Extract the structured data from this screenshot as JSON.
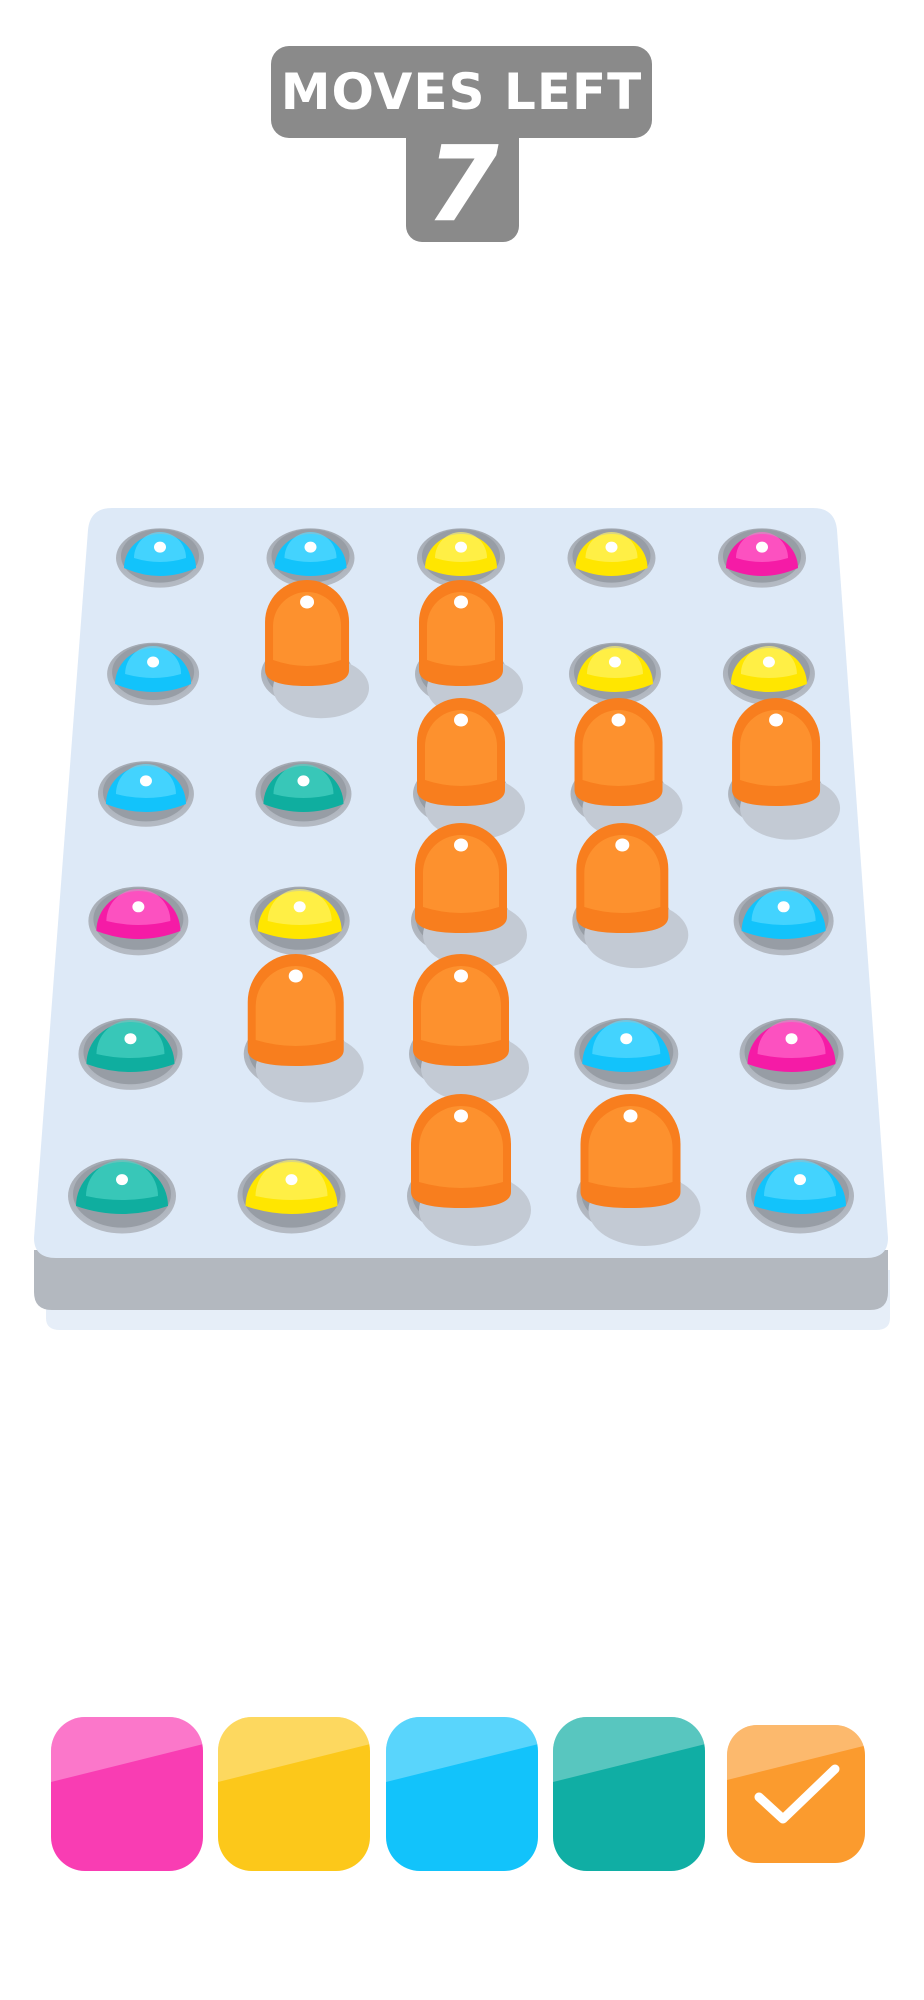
{
  "header": {
    "moves_label": "MOVES LEFT",
    "moves_value": "7"
  },
  "colors": {
    "pink": "#f93db3",
    "yellow": "#fcc81a",
    "blue": "#12c3fb",
    "teal": "#10aea4",
    "orange": "#fb9b2e",
    "board": "#dde9f7",
    "badge": "#8a8a8a"
  },
  "board": {
    "rows": 6,
    "cols": 5,
    "cells": [
      [
        "blue",
        "blue",
        "yellow",
        "yellow",
        "pink"
      ],
      [
        "blue",
        "orange-peg",
        "orange-peg",
        "yellow",
        "yellow"
      ],
      [
        "blue",
        "teal",
        "orange-peg",
        "orange-peg",
        "orange-peg"
      ],
      [
        "pink",
        "yellow",
        "orange-peg",
        "orange-peg",
        "blue"
      ],
      [
        "teal",
        "orange-peg",
        "orange-peg",
        "blue",
        "pink"
      ],
      [
        "teal",
        "yellow",
        "orange-peg",
        "orange-peg",
        "blue"
      ]
    ]
  },
  "palette": {
    "swatches": [
      "pink",
      "yellow",
      "blue",
      "teal",
      "orange"
    ],
    "selected": "orange",
    "selected_icon": "checkmark-icon"
  }
}
